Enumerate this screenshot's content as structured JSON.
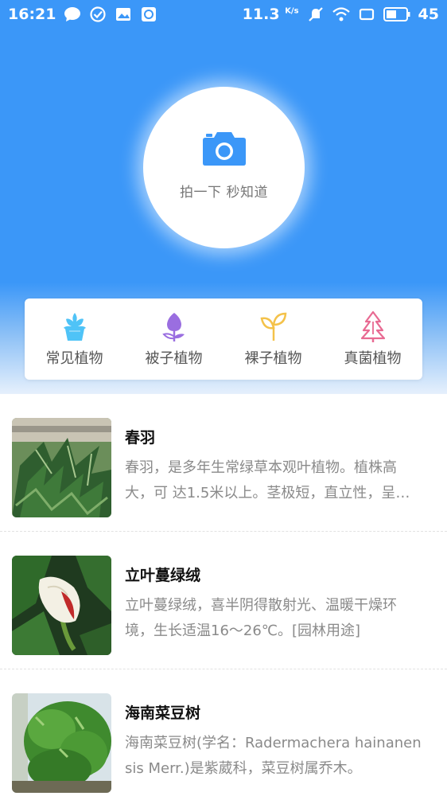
{
  "status_bar": {
    "time": "16:21",
    "net_speed": "11.3",
    "net_unit": "K/s",
    "battery": "45"
  },
  "scan": {
    "icon": "camera-icon",
    "label": "拍一下 秒知道"
  },
  "categories": [
    {
      "label": "常见植物",
      "icon": "potted-plant-icon",
      "color": "#4fc3f7"
    },
    {
      "label": "被子植物",
      "icon": "flower-bud-icon",
      "color": "#9a6ee0"
    },
    {
      "label": "裸子植物",
      "icon": "sprout-icon",
      "color": "#f4c24a"
    },
    {
      "label": "真菌植物",
      "icon": "pine-tree-icon",
      "color": "#e86a92"
    }
  ],
  "plants": [
    {
      "title": "春羽",
      "desc": "春羽，是多年生常绿草本观叶植物。植株高大，可 达1.5米以上。茎极短，直立性，呈木质化。"
    },
    {
      "title": "立叶蔓绿绒",
      "desc": "立叶蔓绿绒，喜半阴得散射光、温暖干燥环境，生长适温16～26℃。[园林用途]"
    },
    {
      "title": "海南菜豆树",
      "desc": "海南菜豆树(学名：Radermachera hainanensis Merr.)是紫葳科，菜豆树属乔木。"
    }
  ],
  "colors": {
    "primary": "#3b97f8",
    "title_text": "#111111",
    "desc_text": "#8a8a8a"
  }
}
